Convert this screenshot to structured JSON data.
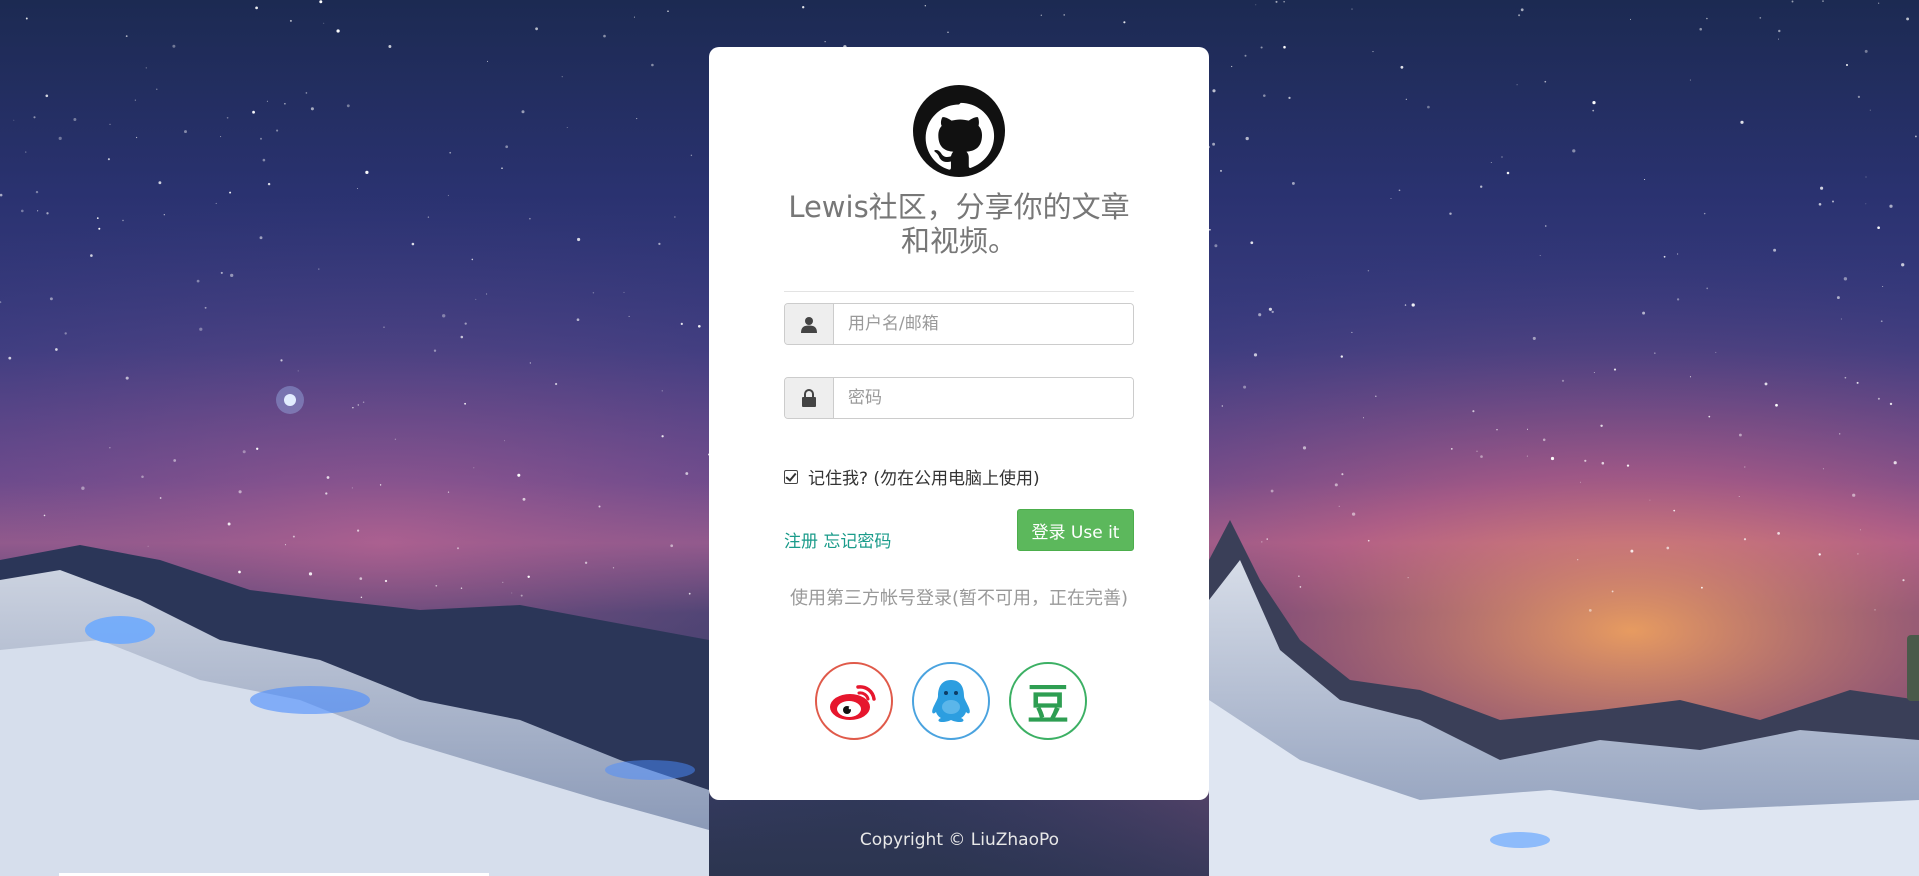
{
  "card": {
    "title": "Lewis社区，分享你的文章和视频。"
  },
  "form": {
    "username_placeholder": "用户名/邮箱",
    "password_placeholder": "密码",
    "remember_label": "记住我? (勿在公用电脑上使用)",
    "remember_checked": true,
    "register_link": "注册",
    "forgot_link": "忘记密码",
    "login_button": "登录 Use it"
  },
  "third_party": {
    "title": "使用第三方帐号登录(暂不可用，正在完善)",
    "providers": [
      {
        "name": "weibo-icon",
        "color": "#e05a4a"
      },
      {
        "name": "qq-icon",
        "color": "#4aa3df"
      },
      {
        "name": "douban-icon",
        "label": "豆",
        "color": "#3cb064"
      }
    ]
  },
  "footer": {
    "copyright": "Copyright © LiuZhaoPo"
  },
  "colors": {
    "accent_green": "#5cb85c",
    "link_teal": "#1a9b8a"
  }
}
